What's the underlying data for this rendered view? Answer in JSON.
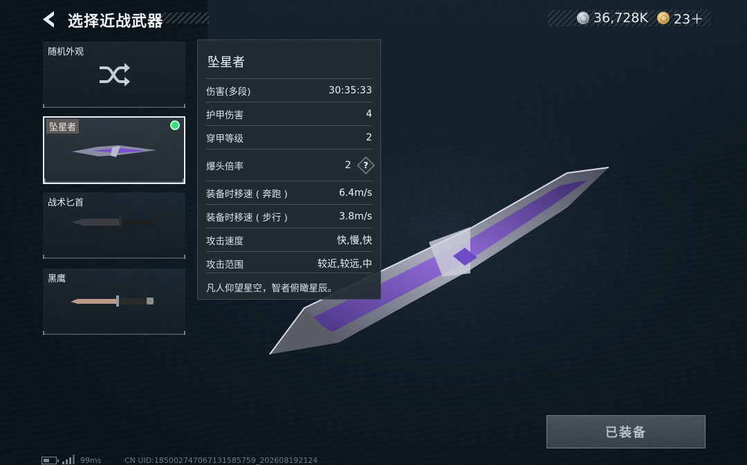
{
  "header": {
    "title": "选择近战武器",
    "currency": [
      {
        "icon": "silver-coin-icon",
        "value": "36,728K"
      },
      {
        "icon": "gold-coin-icon",
        "value": "23＋"
      }
    ]
  },
  "weapons": [
    {
      "label": "随机外观",
      "icon": "shuffle-icon"
    },
    {
      "label": "坠星者",
      "selected": true,
      "equipped": true
    },
    {
      "label": "战术匕首"
    },
    {
      "label": "黑鹰"
    }
  ],
  "stats": {
    "name": "坠星者",
    "rows": [
      {
        "label": "伤害(多段)",
        "value": "30:35:33"
      },
      {
        "label": "护甲伤害",
        "value": "4"
      },
      {
        "label": "穿甲等级",
        "value": "2"
      },
      {
        "label": "爆头倍率",
        "value": "2",
        "help": "?"
      },
      {
        "label": "装备时移速 ( 奔跑 )",
        "value": "6.4m/s"
      },
      {
        "label": "装备时移速 ( 步行 )",
        "value": "3.8m/s"
      },
      {
        "label": "攻击速度",
        "value": "快,慢,快"
      },
      {
        "label": "攻击范围",
        "value": "较近,较远,中"
      }
    ],
    "flavor": "凡人仰望星空，智者俯瞰星辰。"
  },
  "equip_button": "已装备",
  "footer": {
    "ping": "99ms",
    "uid": "CN UID:185002747067131585759_202608192124"
  },
  "colors": {
    "equipped_indicator": "#2fe07a",
    "knife_purple": "#7a4fd0"
  }
}
